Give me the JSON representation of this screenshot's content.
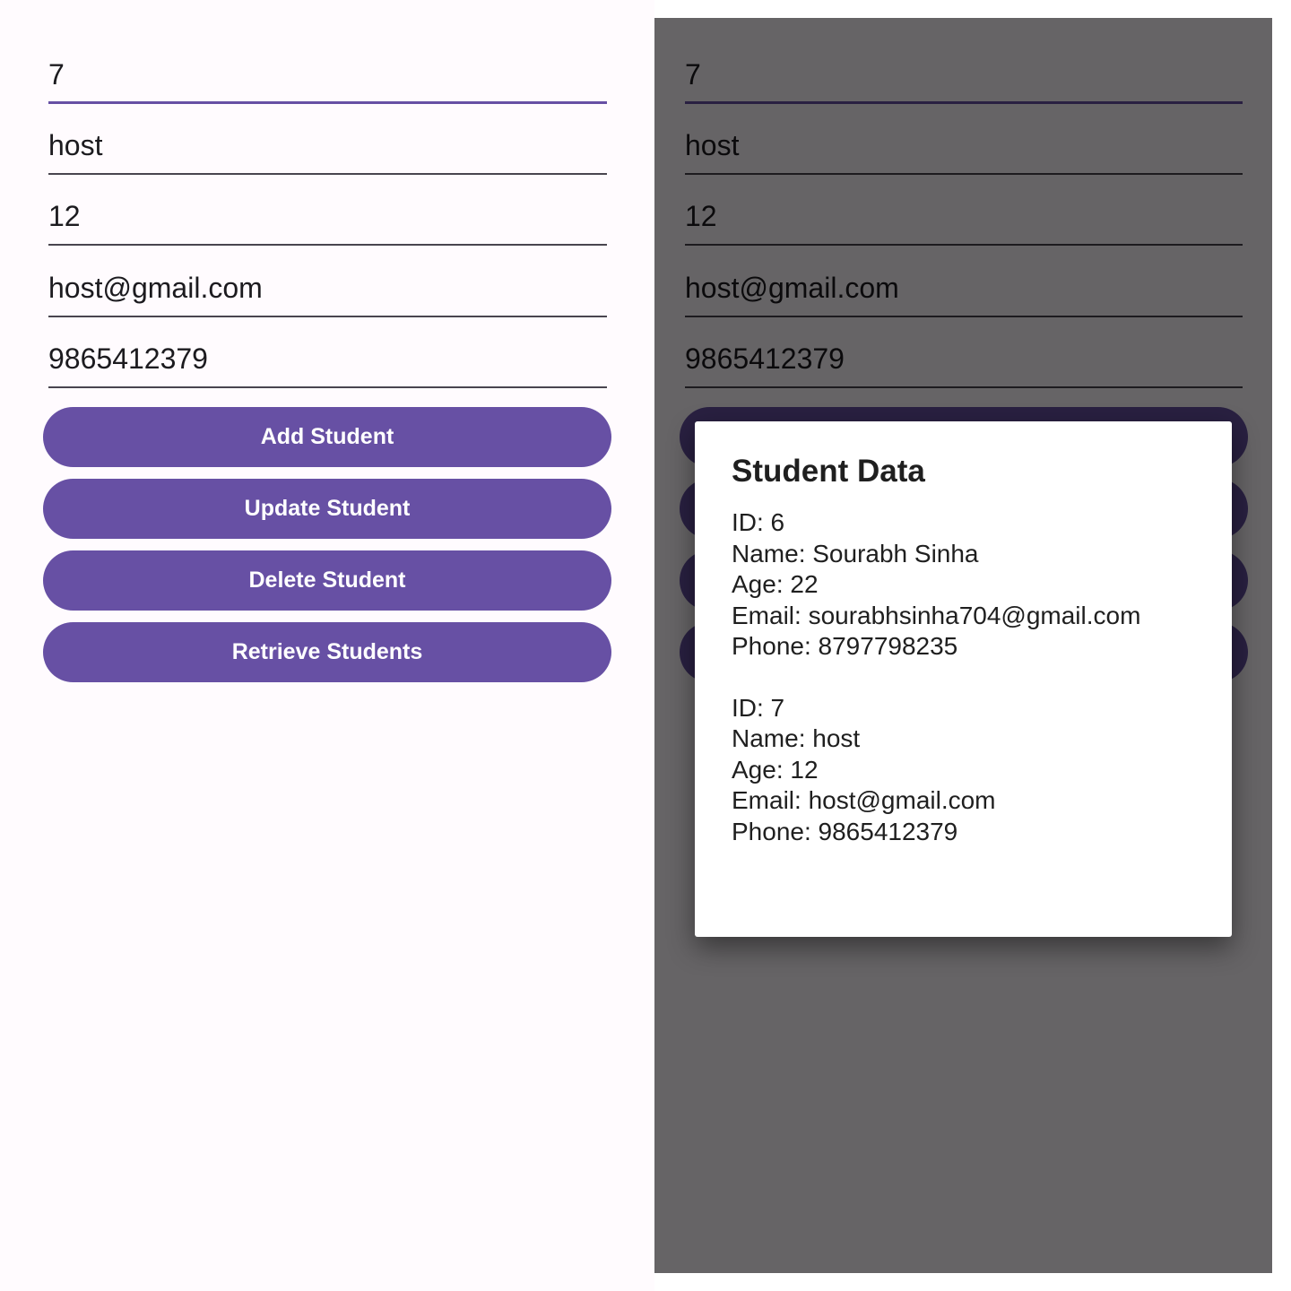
{
  "colors": {
    "primary": "#6750a4",
    "background": "#fffbfe",
    "scrim": "#000000",
    "text": "#1c1b1f"
  },
  "form": {
    "id_value": "7",
    "name_value": "host",
    "age_value": "12",
    "email_value": "host@gmail.com",
    "phone_value": "9865412379"
  },
  "buttons": {
    "add_label": "Add Student",
    "update_label": "Update Student",
    "delete_label": "Delete Student",
    "retrieve_label": "Retrieve Students"
  },
  "dialog": {
    "title": "Student Data",
    "records": [
      {
        "id": "ID: 6",
        "name": "Name: Sourabh Sinha",
        "age": "Age: 22",
        "email": "Email: sourabhsinha704@gmail.com",
        "phone": "Phone: 8797798235"
      },
      {
        "id": "ID: 7",
        "name": "Name: host",
        "age": "Age: 12",
        "email": "Email: host@gmail.com",
        "phone": "Phone: 9865412379"
      }
    ]
  }
}
